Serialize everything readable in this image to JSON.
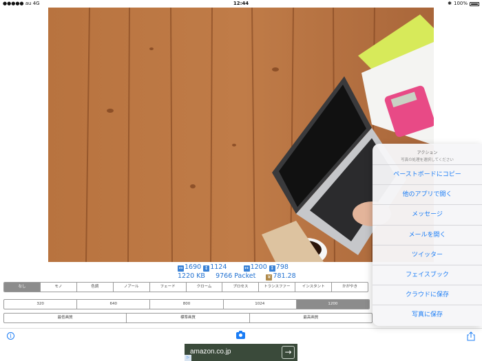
{
  "status_bar": {
    "carrier": "●●●●● au  4G",
    "time": "12:44",
    "battery": "100%"
  },
  "stats": {
    "orig_width": "1690",
    "orig_height": "1124",
    "new_width": "1200",
    "new_height": "798",
    "file_size": "1220 KB",
    "packets": "9766 Packet",
    "cost": "781.28"
  },
  "filters": {
    "options": [
      "なし",
      "モノ",
      "色調",
      "ノアール",
      "フェード",
      "クローム",
      "プロセス",
      "トランスファー",
      "インスタント",
      "かがやき"
    ],
    "selected": "なし"
  },
  "sizes": {
    "options": [
      "320",
      "640",
      "800",
      "1024",
      "1200"
    ],
    "selected": "1200"
  },
  "quality": {
    "options": [
      "最低画質",
      "標準画質",
      "最高画質"
    ]
  },
  "action_sheet": {
    "title": "アクション",
    "subtitle": "写真の処理を選択してください",
    "items": [
      "ペーストボードにコピー",
      "他のアプリで開く",
      "メッセージ",
      "メールを開く",
      "ツイッター",
      "フェイスブック",
      "クラウドに保存",
      "写真に保存"
    ]
  },
  "toolbar": {
    "info_icon": "info-icon",
    "camera_icon": "camera-icon",
    "share_icon": "share-icon"
  },
  "ad": {
    "label": "amazon.co.jp",
    "arrow": "→"
  },
  "colors": {
    "accent": "#1a7cf5",
    "stats_text": "#1e6fd0",
    "selected_segment": "#8c8c8c",
    "wood": "#b06a3a"
  }
}
